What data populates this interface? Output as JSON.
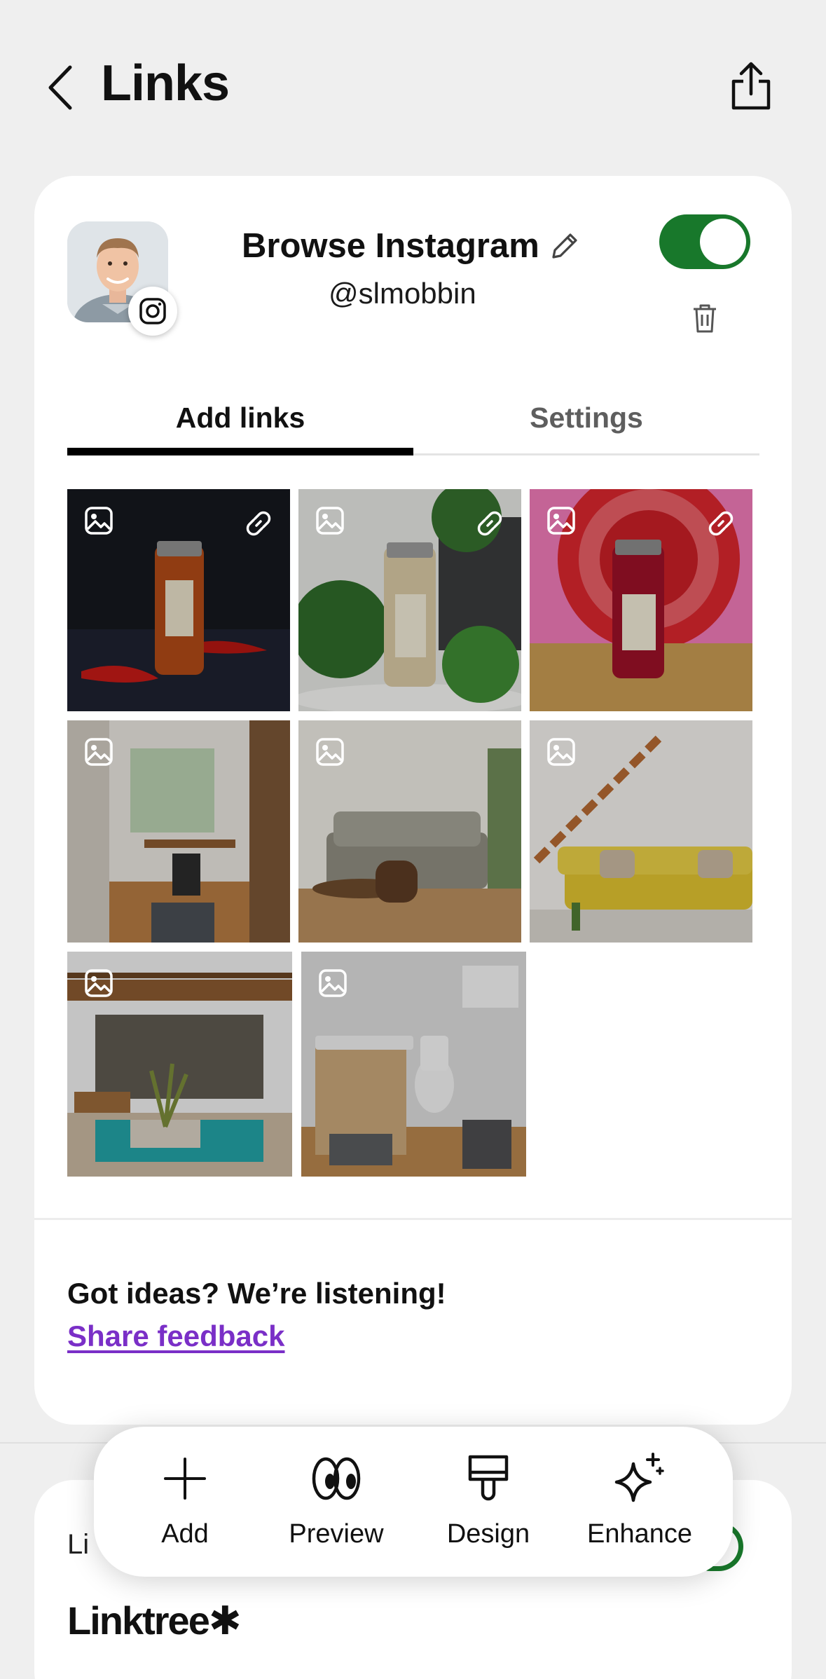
{
  "header": {
    "title": "Links"
  },
  "profile": {
    "name": "Browse Instagram",
    "handle": "@slmobbin",
    "enabled": true
  },
  "tabs": [
    {
      "label": "Add links",
      "active": true
    },
    {
      "label": "Settings",
      "active": false
    }
  ],
  "media_grid": {
    "tiles": [
      {
        "kind": "image",
        "subject": "spice jar with red chili peppers",
        "has_link": true
      },
      {
        "kind": "image",
        "subject": "spice jar with green plants",
        "has_link": true
      },
      {
        "kind": "image",
        "subject": "red spice jar on pink background",
        "has_link": true
      },
      {
        "kind": "image",
        "subject": "home office through doorway",
        "has_link": false
      },
      {
        "kind": "image",
        "subject": "living room with grey sofa",
        "has_link": false
      },
      {
        "kind": "image",
        "subject": "yellow sofa under wooden staircase",
        "has_link": false
      },
      {
        "kind": "image",
        "subject": "patio with pool",
        "has_link": false
      },
      {
        "kind": "image",
        "subject": "bathroom with wooden vanity",
        "has_link": false
      }
    ]
  },
  "feedback": {
    "question": "Got ideas? We’re listening!",
    "link_label": "Share feedback"
  },
  "next_card": {
    "partial_title": "Li",
    "brand": "Linktree✱"
  },
  "action_bar": {
    "items": [
      {
        "label": "Add",
        "icon": "plus-icon"
      },
      {
        "label": "Preview",
        "icon": "eyes-icon"
      },
      {
        "label": "Design",
        "icon": "paint-brush-icon"
      },
      {
        "label": "Enhance",
        "icon": "sparkle-icon"
      }
    ]
  },
  "colors": {
    "background": "#efefef",
    "toggle_on": "#18782b",
    "link": "#7a2fc7"
  }
}
